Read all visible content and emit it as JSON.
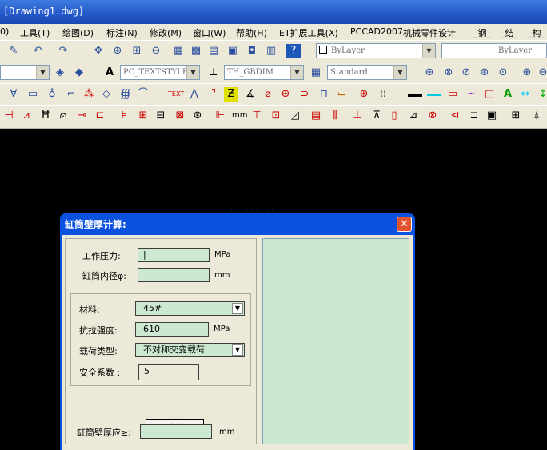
{
  "window": {
    "title": "[Drawing1.dwg]"
  },
  "menu": [
    "0)",
    "工具(T)",
    "绘图(D)",
    "标注(N)",
    "修改(M)",
    "窗口(W)",
    "帮助(H)",
    "ET扩展工具(X)",
    "PCCAD2007",
    "机械零件设计",
    "_钢_",
    "_结_",
    "_构_"
  ],
  "toolbar1": {
    "layer_combo": "ByLayer",
    "linetype_combo": "ByLayer"
  },
  "toolbar2": {
    "textstyle_combo": "PC_TEXTSTYLE",
    "dimstyle_combo": "TH_GBDIM",
    "tablestyle_combo": "Standard"
  },
  "colors": {
    "title_blue": "#0a51e0",
    "field_green": "#cce8d1",
    "dialog_bg": "#ece9d8"
  },
  "dialog": {
    "title": "缸筒壁厚计算:",
    "close_glyph": "✕",
    "pressure_label": "工作压力:",
    "pressure_value": "|",
    "pressure_unit": "MPa",
    "bore_label": "缸筒内径φ:",
    "bore_value": "",
    "bore_unit": "mm",
    "material_label": "材料:",
    "material_value": "45#",
    "strength_label": "抗拉强度:",
    "strength_value": "610",
    "strength_unit": "MPa",
    "load_label": "载荷类型:",
    "load_value": "不对称交变载荷",
    "safety_label": "安全系数 :",
    "safety_value": "5",
    "calc_button": "计算",
    "result_label": "缸筒壁厚应≥:",
    "result_value": "",
    "result_unit": "mm"
  }
}
